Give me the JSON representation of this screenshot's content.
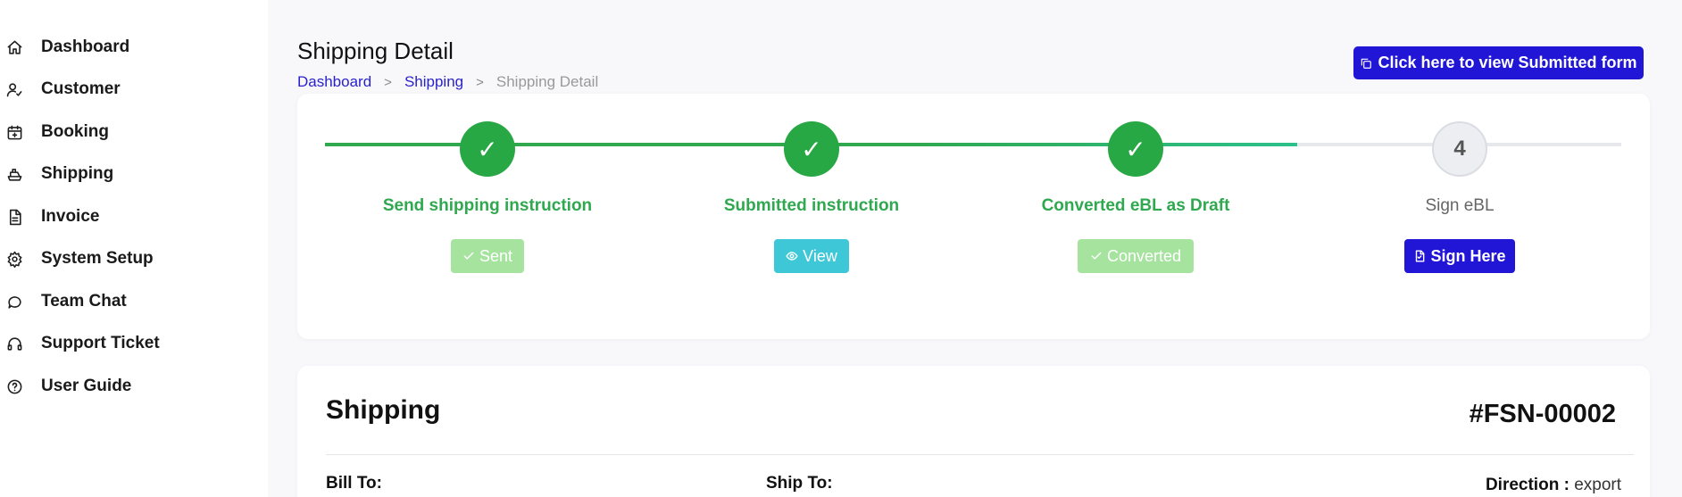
{
  "sidebar": {
    "items": [
      {
        "label": "Dashboard",
        "icon": "home-icon"
      },
      {
        "label": "Customer",
        "icon": "user-check-icon"
      },
      {
        "label": "Booking",
        "icon": "calendar-plus-icon"
      },
      {
        "label": "Shipping",
        "icon": "ship-icon"
      },
      {
        "label": "Invoice",
        "icon": "document-icon"
      },
      {
        "label": "System Setup",
        "icon": "gear-icon"
      },
      {
        "label": "Team Chat",
        "icon": "chat-icon"
      },
      {
        "label": "Support Ticket",
        "icon": "headphones-icon"
      },
      {
        "label": "User Guide",
        "icon": "help-circle-icon"
      }
    ]
  },
  "header": {
    "title": "Shipping Detail",
    "breadcrumb": [
      "Dashboard",
      "Shipping",
      "Shipping Detail"
    ],
    "view_form_label": "Click here to view Submitted form"
  },
  "steps": [
    {
      "number": "✓",
      "label": "Send shipping instruction",
      "button": "Sent",
      "status": "done"
    },
    {
      "number": "✓",
      "label": "Submitted instruction",
      "button": "View",
      "status": "done"
    },
    {
      "number": "✓",
      "label": "Converted eBL as Draft",
      "button": "Converted",
      "status": "done"
    },
    {
      "number": "4",
      "label": "Sign eBL",
      "button": "Sign Here",
      "status": "pending"
    }
  ],
  "progress_fraction": 0.75,
  "shipping": {
    "title": "Shipping",
    "number": "#FSN-00002",
    "bill_to_label": "Bill To:",
    "ship_to_label": "Ship To:",
    "direction_label": "Direction :",
    "direction_value": "export"
  },
  "colors": {
    "primary": "#2115d6",
    "success": "#28a745",
    "success_light": "#a6e39f",
    "info": "#3ec7d6"
  }
}
